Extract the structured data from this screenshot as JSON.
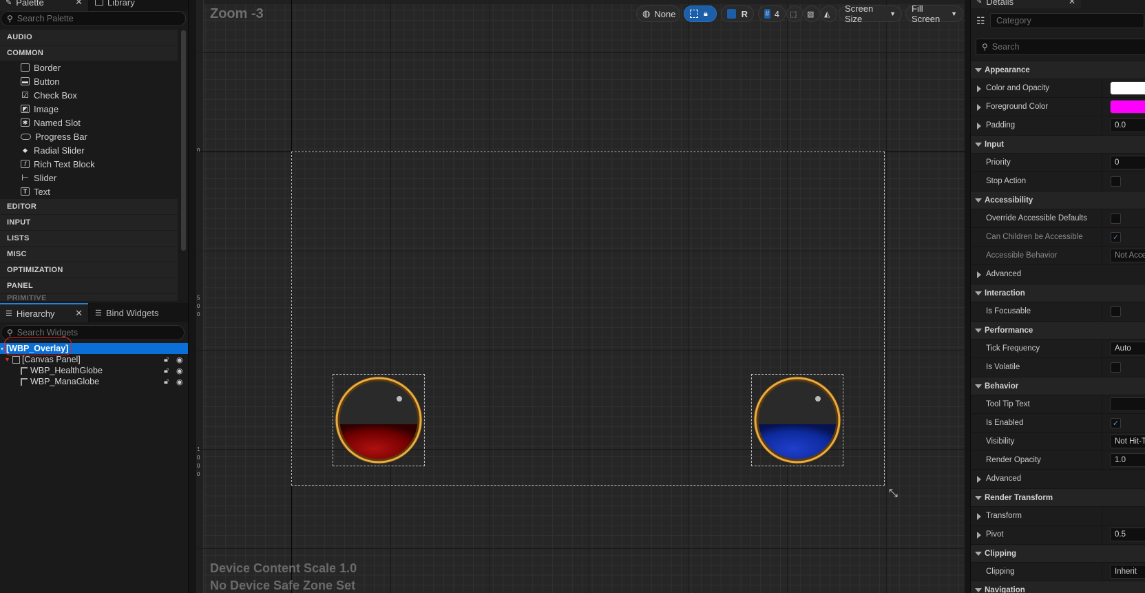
{
  "palette": {
    "tab_label": "Palette",
    "library_tab_label": "Library",
    "search_placeholder": "Search Palette",
    "categories_top": [
      "AUDIO",
      "COMMON"
    ],
    "common_items": [
      {
        "label": "Border",
        "icon": "border-icon"
      },
      {
        "label": "Button",
        "icon": "button-icon"
      },
      {
        "label": "Check Box",
        "icon": "checkbox-icon"
      },
      {
        "label": "Image",
        "icon": "image-icon"
      },
      {
        "label": "Named Slot",
        "icon": "named-slot-icon"
      },
      {
        "label": "Progress Bar",
        "icon": "progress-bar-icon"
      },
      {
        "label": "Radial Slider",
        "icon": "radial-slider-icon"
      },
      {
        "label": "Rich Text Block",
        "icon": "rich-text-icon"
      },
      {
        "label": "Slider",
        "icon": "slider-icon"
      },
      {
        "label": "Text",
        "icon": "text-icon"
      }
    ],
    "categories_bottom": [
      "EDITOR",
      "INPUT",
      "LISTS",
      "MISC",
      "OPTIMIZATION",
      "PANEL",
      "PRIMITIVE"
    ]
  },
  "hierarchy": {
    "tab_label": "Hierarchy",
    "bind_tab_label": "Bind Widgets",
    "search_placeholder": "Search Widgets",
    "root": "[WBP_Overlay]",
    "canvas": "[Canvas Panel]",
    "children": [
      "WBP_HealthGlobe",
      "WBP_ManaGlobe"
    ]
  },
  "viewport": {
    "zoom_label": "Zoom -3",
    "device_scale": "Device Content Scale 1.0",
    "safe_zone": "No Device Safe Zone Set",
    "toolbar": {
      "none_label": "None",
      "r_label": "R",
      "grid_value": "4",
      "screen_size": "Screen Size",
      "fill_screen": "Fill Screen"
    },
    "ruler_labels": {
      "zero": "0",
      "mid": [
        "5",
        "0",
        "0"
      ],
      "low": [
        "1",
        "0",
        "0",
        "0"
      ]
    },
    "health_globe_fill": 0.45,
    "mana_globe_fill": 0.45,
    "colors": {
      "health": "#8b0000",
      "mana": "#0d2a9c",
      "rim": "#d9a441",
      "selection": "#1c5ea8"
    }
  },
  "details": {
    "title": "Details",
    "category_placeholder": "Category",
    "search_placeholder": "Search",
    "sections": {
      "appearance": "Appearance",
      "input": "Input",
      "accessibility": "Accessibility",
      "interaction": "Interaction",
      "performance": "Performance",
      "behavior": "Behavior",
      "render_transform": "Render Transform",
      "clipping": "Clipping",
      "navigation": "Navigation"
    },
    "rows": {
      "color_opacity": "Color and Opacity",
      "foreground_color": "Foreground Color",
      "padding": "Padding",
      "padding_val": "0.0",
      "priority": "Priority",
      "priority_val": "0",
      "stop_action": "Stop Action",
      "override_access": "Override Accessible Defaults",
      "children_access": "Can Children be Accessible",
      "access_behavior": "Accessible Behavior",
      "access_behavior_val": "Not Accessible",
      "advanced": "Advanced",
      "is_focusable": "Is Focusable",
      "tick_frequency": "Tick Frequency",
      "tick_frequency_val": "Auto",
      "is_volatile": "Is Volatile",
      "tooltip": "Tool Tip Text",
      "is_enabled": "Is Enabled",
      "visibility": "Visibility",
      "visibility_val": "Not Hit-Testable",
      "render_opacity": "Render Opacity",
      "render_opacity_val": "1.0",
      "transform": "Transform",
      "pivot": "Pivot",
      "pivot_val": "0.5",
      "clipping": "Clipping",
      "clipping_val": "Inherit"
    },
    "color_swatch_white": "#ffffff",
    "color_swatch_magenta": "#ff00ff"
  }
}
